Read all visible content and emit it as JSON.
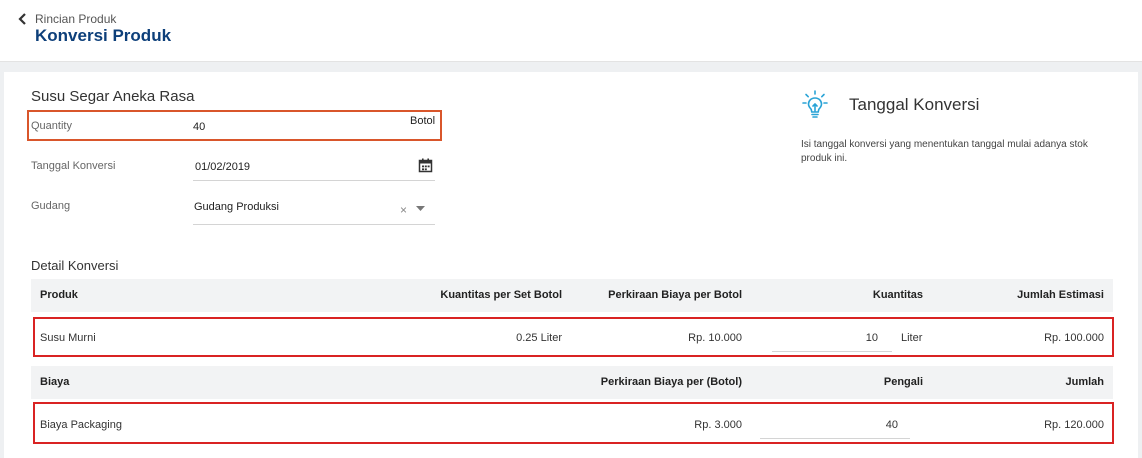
{
  "header": {
    "back_label": "Rincian Produk",
    "title": "Konversi Produk"
  },
  "product": {
    "name": "Susu Segar Aneka Rasa",
    "quantity_label": "Quantity",
    "quantity_value": "40",
    "quantity_unit": "Botol",
    "date_label": "Tanggal Konversi",
    "date_value": "01/02/2019",
    "warehouse_label": "Gudang",
    "warehouse_value": "Gudang Produksi"
  },
  "info": {
    "title": "Tanggal Konversi",
    "description": "Isi tanggal konversi yang menentukan tanggal mulai adanya stok produk ini."
  },
  "detail": {
    "title": "Detail Konversi",
    "product_headers": [
      "Produk",
      "Kuantitas per Set Botol",
      "Perkiraan Biaya per Botol",
      "Kuantitas",
      "Jumlah Estimasi"
    ],
    "product_row": {
      "name": "Susu Murni",
      "qty_per_set": "0.25 Liter",
      "cost_per_unit": "Rp. 10.000",
      "quantity": "10",
      "unit": "Liter",
      "estimate": "Rp. 100.000"
    },
    "cost_headers": [
      "Biaya",
      "Perkiraan Biaya per (Botol)",
      "Pengali",
      "Jumlah"
    ],
    "cost_row": {
      "name": "Biaya Packaging",
      "cost_per_unit": "Rp. 3.000",
      "multiplier": "40",
      "total": "Rp. 120.000"
    }
  },
  "colors": {
    "title_blue": "#0d3f7a",
    "highlight_orange": "#d9562b",
    "highlight_red": "#d92323",
    "info_icon": "#29a3d6"
  },
  "icons": [
    "chevron-left-icon",
    "calendar-icon",
    "clear-icon",
    "caret-down-icon",
    "lightbulb-icon"
  ]
}
